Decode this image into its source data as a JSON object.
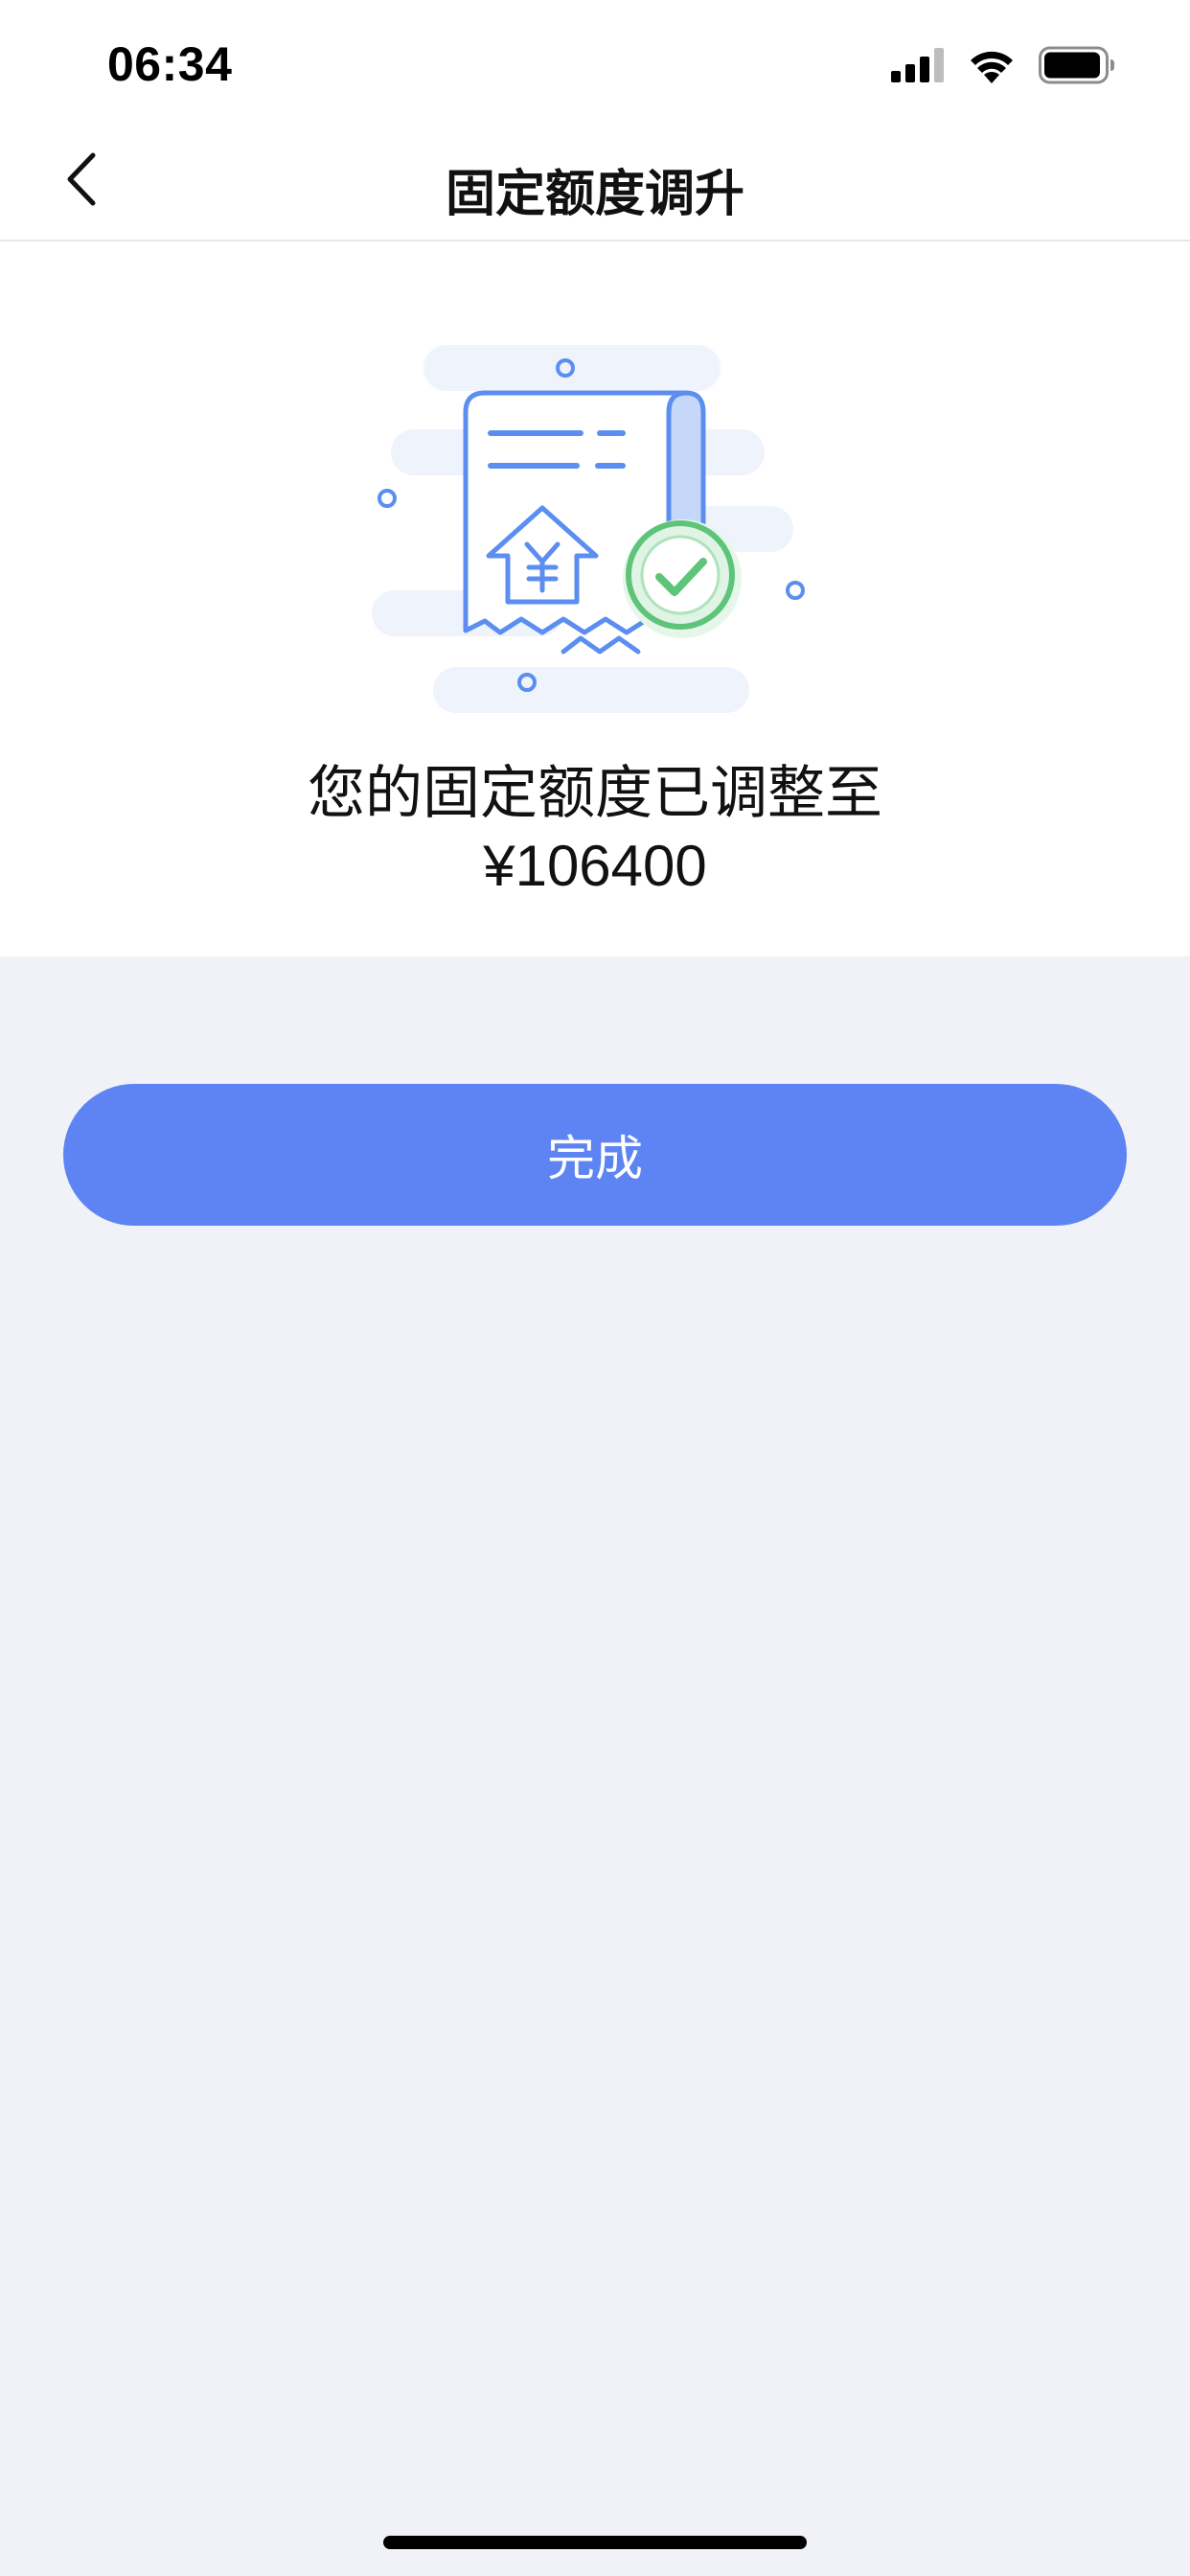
{
  "status_bar": {
    "time": "06:34",
    "icons": [
      "cellular-signal-icon",
      "wifi-icon",
      "battery-icon"
    ]
  },
  "nav": {
    "back_icon": "chevron-left-icon",
    "title": "固定额度调升"
  },
  "result": {
    "illustration_icon": "receipt-success-icon",
    "message": "您的固定额度已调整至",
    "amount": "¥106400"
  },
  "actions": {
    "done_label": "完成"
  },
  "colors": {
    "accent": "#5e84f3",
    "success": "#5ec47a",
    "page_background": "#f1f2f7",
    "card_background": "#ffffff"
  }
}
